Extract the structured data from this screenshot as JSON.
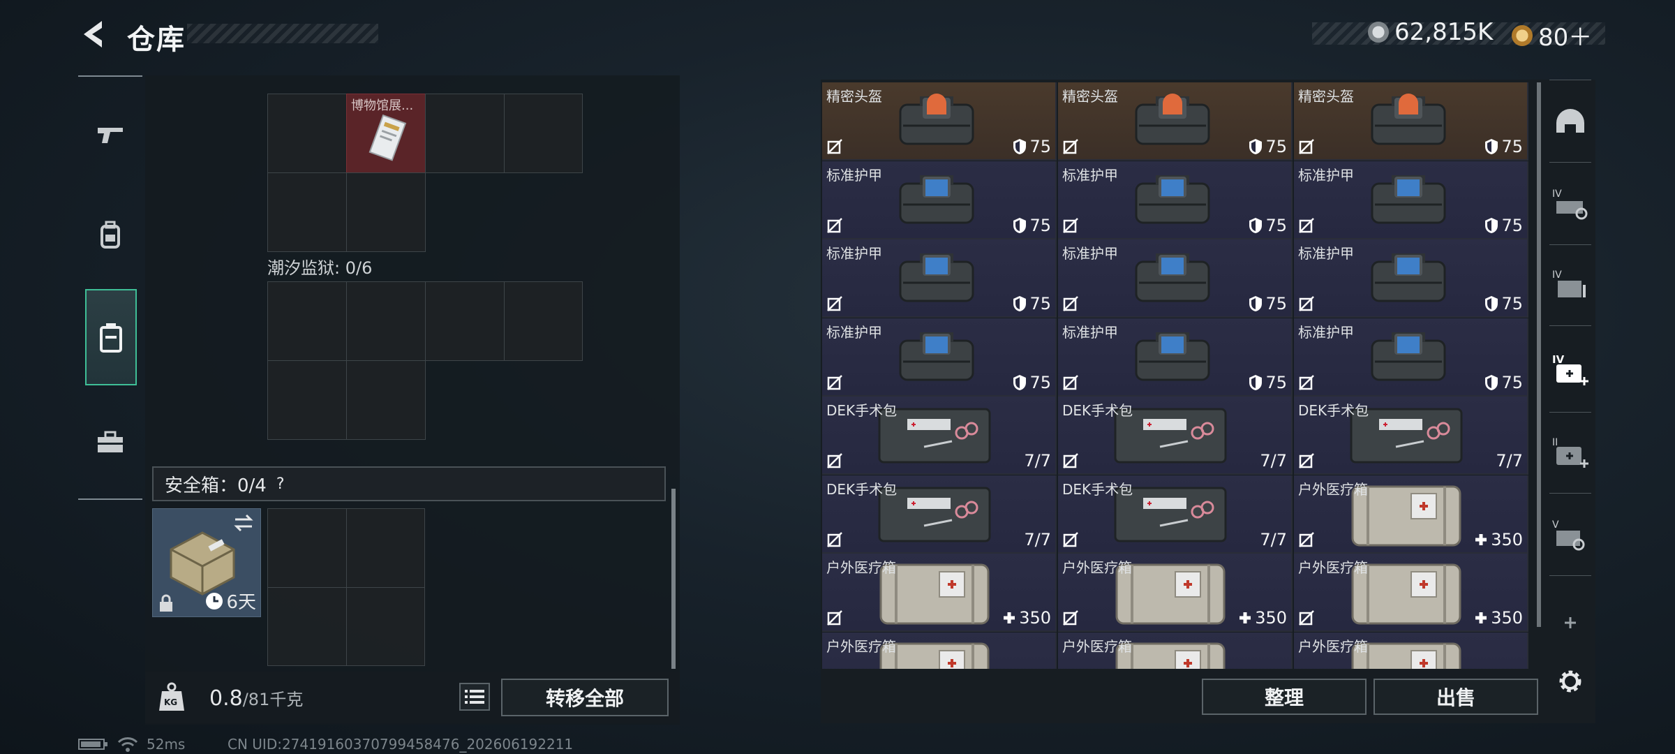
{
  "header": {
    "title": "仓库",
    "currency_1": "62,815K",
    "currency_2": "80＋"
  },
  "left_nav": [
    {
      "name": "weapons",
      "icon": "pistol-icon"
    },
    {
      "name": "gear",
      "icon": "backpack-icon"
    },
    {
      "name": "containers",
      "icon": "case-icon",
      "active": true
    },
    {
      "name": "toolbox",
      "icon": "toolbox-icon"
    }
  ],
  "storage": {
    "top_item_label": "博物馆展...",
    "section_2_label": "潮汐监狱: 0/6",
    "safe_label": "安全箱：0/4",
    "safe_help": "?",
    "safe_duration": "6天"
  },
  "weight": {
    "current": "0.8",
    "max": "/81千克",
    "icon_text": "KG",
    "transfer_all": "转移全部"
  },
  "items": [
    {
      "name": "精密头盔",
      "value": "75",
      "kind": "helmet"
    },
    {
      "name": "精密头盔",
      "value": "75",
      "kind": "helmet"
    },
    {
      "name": "精密头盔",
      "value": "75",
      "kind": "helmet"
    },
    {
      "name": "标准护甲",
      "value": "75",
      "kind": "armor"
    },
    {
      "name": "标准护甲",
      "value": "75",
      "kind": "armor"
    },
    {
      "name": "标准护甲",
      "value": "75",
      "kind": "armor"
    },
    {
      "name": "标准护甲",
      "value": "75",
      "kind": "armor"
    },
    {
      "name": "标准护甲",
      "value": "75",
      "kind": "armor"
    },
    {
      "name": "标准护甲",
      "value": "75",
      "kind": "armor"
    },
    {
      "name": "标准护甲",
      "value": "75",
      "kind": "armor"
    },
    {
      "name": "标准护甲",
      "value": "75",
      "kind": "armor"
    },
    {
      "name": "标准护甲",
      "value": "75",
      "kind": "armor"
    },
    {
      "name": "DEK手术包",
      "value": "7/7",
      "kind": "surgery"
    },
    {
      "name": "DEK手术包",
      "value": "7/7",
      "kind": "surgery"
    },
    {
      "name": "DEK手术包",
      "value": "7/7",
      "kind": "surgery"
    },
    {
      "name": "DEK手术包",
      "value": "7/7",
      "kind": "surgery"
    },
    {
      "name": "DEK手术包",
      "value": "7/7",
      "kind": "surgery"
    },
    {
      "name": "户外医疗箱",
      "value": "350",
      "kind": "medkit"
    },
    {
      "name": "户外医疗箱",
      "value": "350",
      "kind": "medkit"
    },
    {
      "name": "户外医疗箱",
      "value": "350",
      "kind": "medkit"
    },
    {
      "name": "户外医疗箱",
      "value": "350",
      "kind": "medkit"
    },
    {
      "name": "户外医疗箱",
      "value": "",
      "kind": "medkit"
    },
    {
      "name": "户外医疗箱",
      "value": "",
      "kind": "medkit"
    },
    {
      "name": "户外医疗箱",
      "value": "",
      "kind": "medkit"
    }
  ],
  "actions": {
    "organize": "整理",
    "sell": "出售"
  },
  "status_bar": {
    "ping": "52ms",
    "uid": "CN UID:27419160370799458476_202606192211"
  },
  "colors": {
    "accent": "#3fbf97",
    "helmet_bg": "#3f3228",
    "item_bg": "#282a42"
  }
}
